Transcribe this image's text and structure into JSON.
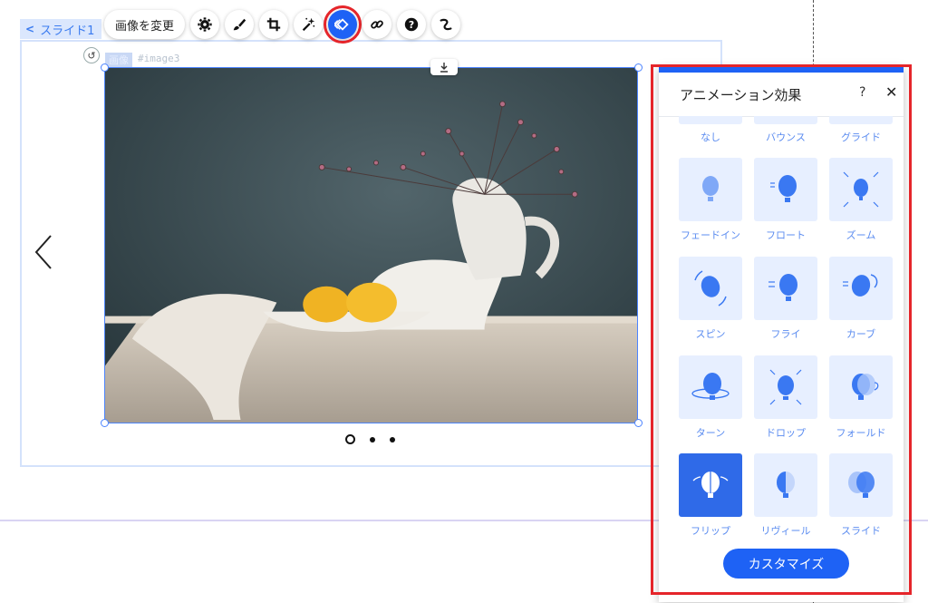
{
  "slide": {
    "label": "スライド1"
  },
  "toolbar": {
    "change_image_label": "画像を変更",
    "icons": [
      "settings-icon",
      "brush-icon",
      "crop-icon",
      "magic-wand-icon",
      "animation-icon",
      "link-icon",
      "help-icon",
      "connect-icon"
    ]
  },
  "image": {
    "tag_type": "画像",
    "tag_id": "#image3"
  },
  "pagination": {
    "total": 3,
    "current": 1
  },
  "panel": {
    "title": "アニメーション効果",
    "help": "?",
    "close": "✕",
    "partial_row": [
      "なし",
      "バウンス",
      "グライド"
    ],
    "effects": [
      {
        "label": "フェードイン",
        "selected": false
      },
      {
        "label": "フロート",
        "selected": false
      },
      {
        "label": "ズーム",
        "selected": false
      },
      {
        "label": "スピン",
        "selected": false
      },
      {
        "label": "フライ",
        "selected": false
      },
      {
        "label": "カーブ",
        "selected": false
      },
      {
        "label": "ターン",
        "selected": false
      },
      {
        "label": "ドロップ",
        "selected": false
      },
      {
        "label": "フォールド",
        "selected": false
      },
      {
        "label": "フリップ",
        "selected": true
      },
      {
        "label": "リヴィール",
        "selected": false
      },
      {
        "label": "スライド",
        "selected": false
      }
    ],
    "customize_label": "カスタマイズ"
  },
  "colors": {
    "accent": "#1e62f5",
    "highlight": "#e5252a",
    "tile_bg": "#e7efff"
  }
}
